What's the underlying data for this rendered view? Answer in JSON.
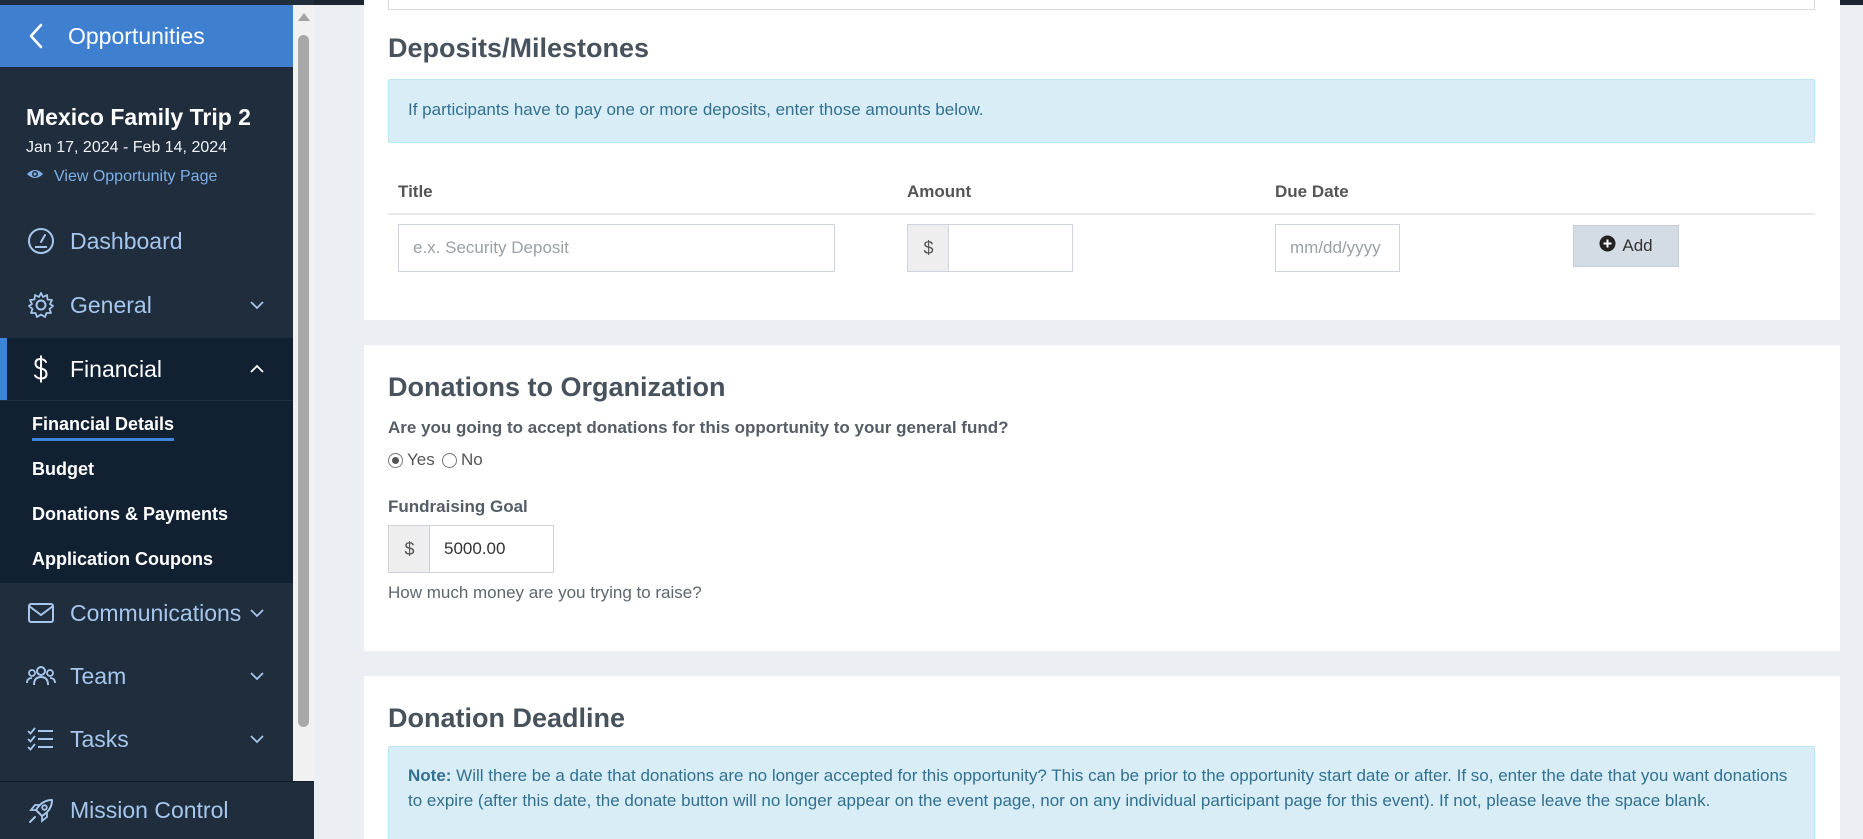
{
  "sidebar": {
    "back_label": "Opportunities",
    "opportunity": {
      "title": "Mexico Family Trip 2",
      "dates": "Jan 17, 2024 - Feb 14, 2024",
      "view_link": "View Opportunity Page"
    },
    "nav": {
      "dashboard": "Dashboard",
      "general": "General",
      "financial": "Financial",
      "communications": "Communications",
      "team": "Team",
      "tasks": "Tasks",
      "mission_control": "Mission Control"
    },
    "financial_sub": [
      "Financial Details",
      "Budget",
      "Donations & Payments",
      "Application Coupons"
    ]
  },
  "deposits": {
    "heading": "Deposits/Milestones",
    "info": "If participants have to pay one or more deposits, enter those amounts below.",
    "col_title": "Title",
    "col_amount": "Amount",
    "col_due": "Due Date",
    "title_placeholder": "e.x. Security Deposit",
    "currency": "$",
    "date_placeholder": "mm/dd/yyyy",
    "add_label": "Add"
  },
  "donations": {
    "heading": "Donations to Organization",
    "question": "Are you going to accept donations for this opportunity to your general fund?",
    "yes_label": "Yes",
    "no_label": "No",
    "goal_label": "Fundraising Goal",
    "currency": "$",
    "goal_value": "5000.00",
    "goal_help": "How much money are you trying to raise?"
  },
  "deadline": {
    "heading": "Donation Deadline",
    "note_label": "Note:",
    "note_text": " Will there be a date that donations are no longer accepted for this opportunity? This can be prior to the opportunity start date or after. If so, enter the date that you want donations to expire (after this date, the donate button will no longer appear on the event page, nor on any individual participant page for this event). If not, please leave the space blank."
  }
}
